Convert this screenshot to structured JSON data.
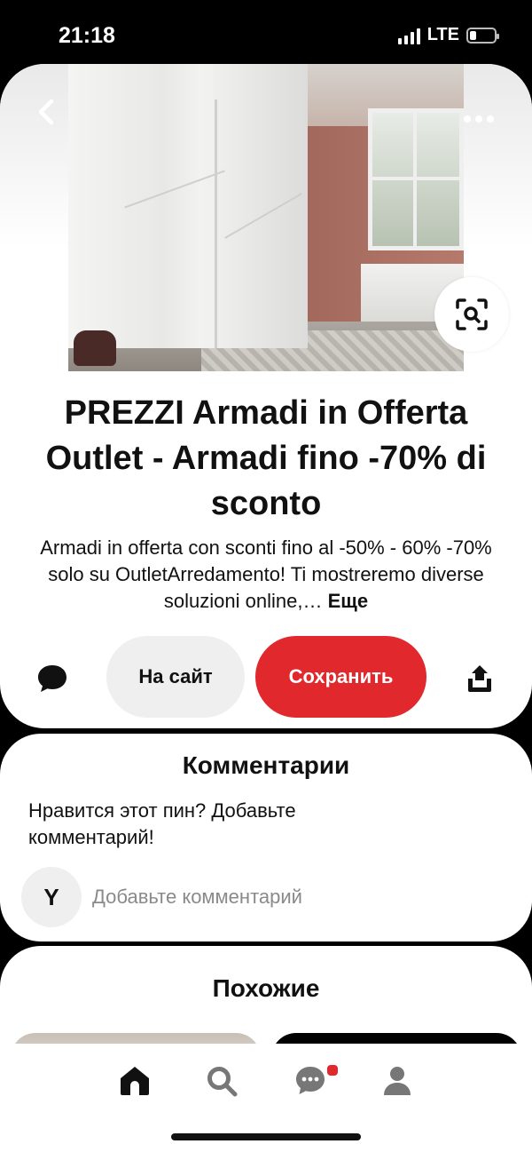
{
  "status_bar": {
    "time": "21:18",
    "network": "LTE"
  },
  "pin": {
    "image_alt": "White sliding-door wardrobe in a bedroom",
    "title": "PREZZI Armadi in Offerta Outlet - Armadi fino -70% di sconto",
    "description": "Armadi in offerta con sconti fino al -50% - 60% -70% solo su OutletArredamento! Ti mostreremo diverse soluzioni online,… ",
    "more_link": "Еще",
    "visit_button": "На сайт",
    "save_button": "Сохранить",
    "icons": {
      "back": "chevron-left-icon",
      "more": "more-horizontal-icon",
      "visual_search": "visual-search-icon",
      "comment": "speech-bubble-icon",
      "share": "share-upload-icon"
    }
  },
  "comments": {
    "title": "Комментарии",
    "prompt": "Нравится этот пин? Добавьте комментарий!",
    "avatar_initial": "Y",
    "input_placeholder": "Добавьте комментарий"
  },
  "similar": {
    "title": "Похожие"
  },
  "bottom_nav": {
    "items": [
      "home-icon",
      "search-icon",
      "messages-icon",
      "profile-icon"
    ],
    "messages_has_notification": true
  },
  "colors": {
    "save_red": "#e0282d",
    "visit_bg": "#efefef",
    "background": "#000000"
  }
}
